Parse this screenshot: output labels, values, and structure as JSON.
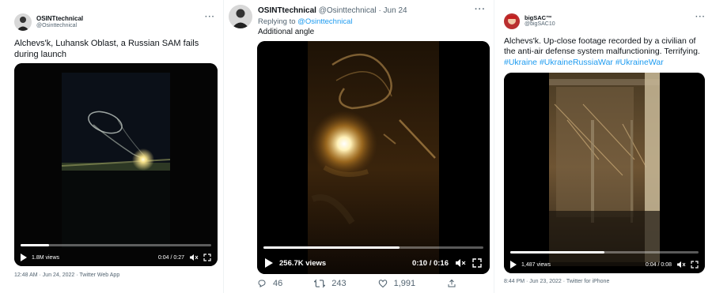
{
  "tweets": [
    {
      "display_name": "OSINTtechnical",
      "handle": "@Osinttechnical",
      "text": "Alchevs'k, Luhansk Oblast, a Russian SAM fails during launch",
      "video": {
        "views": "1.8M views",
        "time": "0:04 / 0:27",
        "progress": 0.15
      },
      "footer": "12:48 AM · Jun 24, 2022 · Twitter Web App"
    },
    {
      "display_name": "OSINTtechnical",
      "handle": "@Osinttechnical",
      "date": "· Jun 24",
      "replying_prefix": "Replying to",
      "replying_handle": "@Osinttechnical",
      "text": "Additional angle",
      "video": {
        "views": "256.7K views",
        "time": "0:10 / 0:16",
        "progress": 0.62
      },
      "actions": {
        "replies": "46",
        "retweets": "243",
        "likes": "1,991"
      }
    },
    {
      "display_name": "bigSAC™",
      "handle": "@bigSAC10",
      "text": "Alchevs'k. Up-close footage recorded by a civilian of the anti-air defense system malfunctioning. Terrifying.",
      "hashtags": "#Ukraine #UkraineRussiaWar #UkraineWar",
      "video": {
        "views": "1,487 views",
        "time": "0:04 / 0:08",
        "progress": 0.5
      },
      "footer": "8:44 PM · Jun 23, 2022 · Twitter for iPhone"
    }
  ],
  "icons": {
    "more": "more-icon",
    "play": "play-icon",
    "volume": "volume-icon",
    "fullscreen": "fullscreen-icon",
    "reply": "reply-icon",
    "retweet": "retweet-icon",
    "like": "like-icon",
    "share": "share-icon"
  },
  "colors": {
    "link": "#1d9bf0",
    "muted": "#536471"
  }
}
